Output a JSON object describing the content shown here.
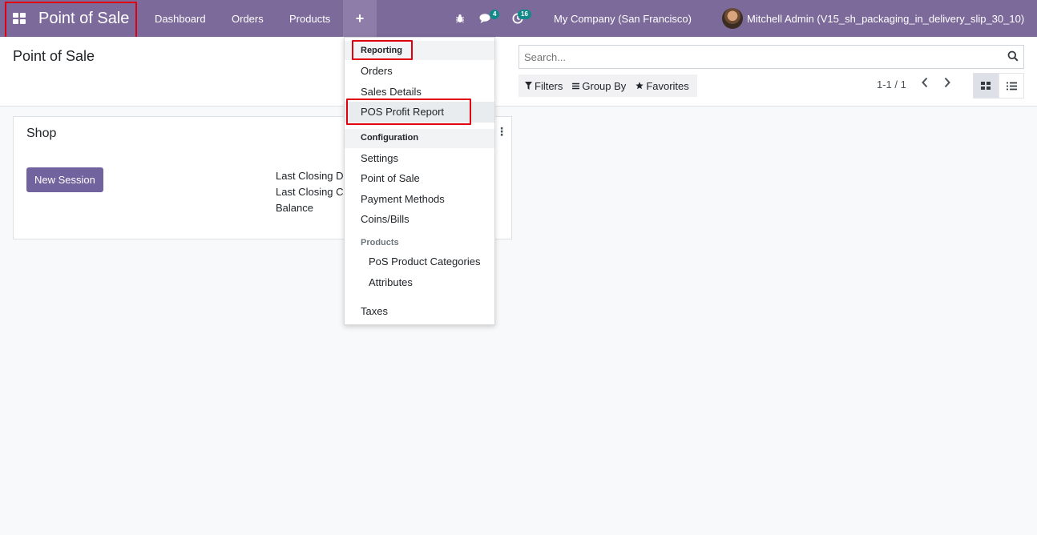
{
  "navbar": {
    "app_title": "Point of Sale",
    "menu": [
      "Dashboard",
      "Orders",
      "Products"
    ],
    "plus_symbol": "+",
    "messages_count": "4",
    "activities_count": "16",
    "company": "My Company (San Francisco)",
    "user": "Mitchell Admin (V15_sh_packaging_in_delivery_slip_30_10)"
  },
  "control_panel": {
    "title": "Point of Sale",
    "search_placeholder": "Search...",
    "filters_label": "Filters",
    "group_by_label": "Group By",
    "favorites_label": "Favorites",
    "pager": "1-1 / 1"
  },
  "card": {
    "name": "Shop",
    "new_session_label": "New Session",
    "meta_lines": [
      "Last Closing D",
      "Last Closing C",
      "Balance"
    ]
  },
  "dropdown": {
    "reporting_header": "Reporting",
    "reporting_items": [
      "Orders",
      "Sales Details",
      "POS Profit Report"
    ],
    "configuration_header": "Configuration",
    "configuration_items": [
      "Settings",
      "Point of Sale",
      "Payment Methods",
      "Coins/Bills"
    ],
    "products_header": "Products",
    "products_items": [
      "PoS Product Categories",
      "Attributes"
    ],
    "taxes_label": "Taxes"
  },
  "colors": {
    "navbar": "#7c6a9b",
    "primary_button": "#71639e",
    "highlight_box": "#e0000f",
    "badge": "#128a8a"
  }
}
